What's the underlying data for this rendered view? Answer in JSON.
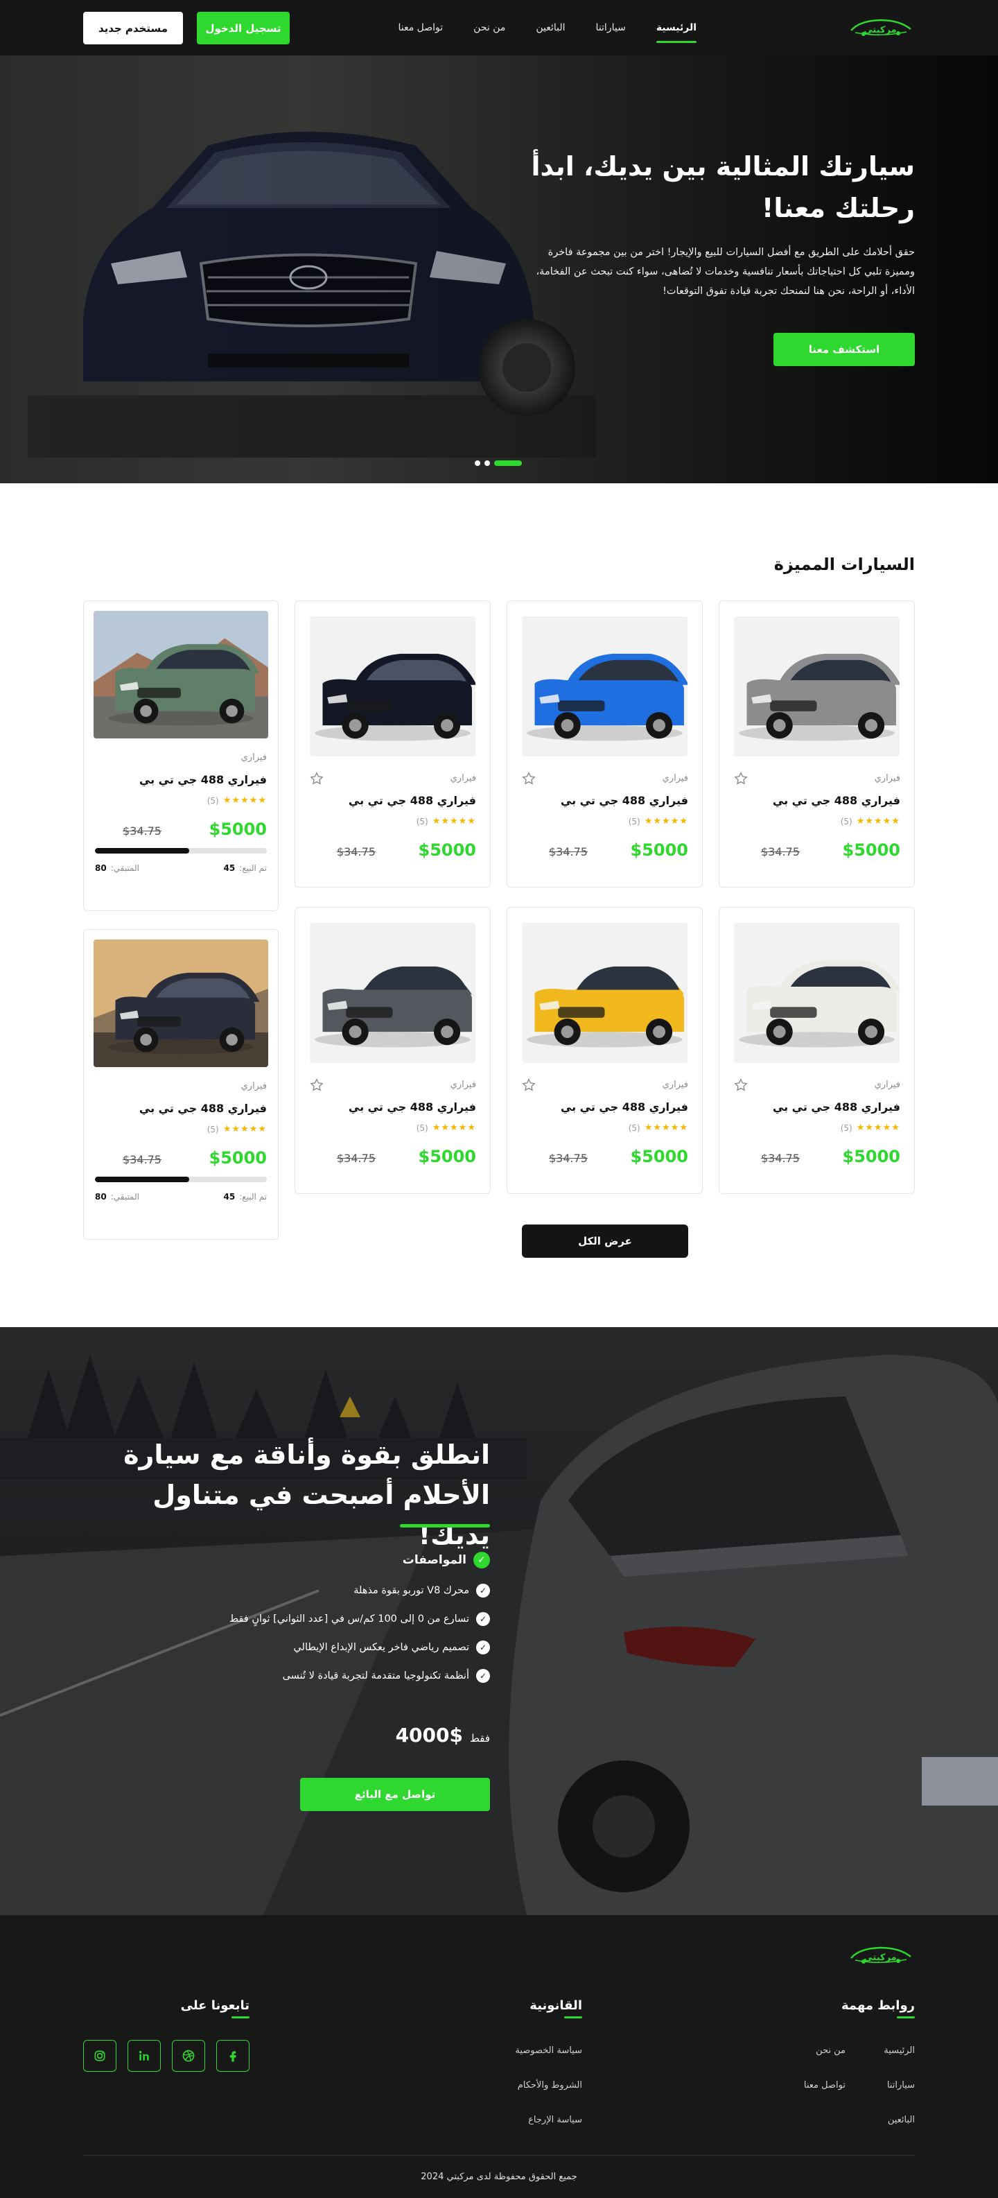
{
  "brand_color": "#2fd82f",
  "logo": {
    "text": "مركبتي"
  },
  "nav": {
    "links": [
      "الرئيسية",
      "سياراتنا",
      "البائعين",
      "من نحن",
      "تواصل معنا"
    ],
    "login_label": "تسجيل الدخول",
    "register_label": "مستخدم جديد"
  },
  "hero": {
    "title": "سيارتك المثالية بين يديك، ابدأ رحلتك معنا!",
    "description": "حقق أحلامك على الطريق مع أفضل السيارات للبيع والإيجار! اختر من بين مجموعة فاخرة ومميزة تلبي كل احتياجاتك بأسعار تنافسية وخدمات لا تُضاهى، سواء كنت تبحث عن الفخامة، الأداء، أو الراحة، نحن هنا لنمنحك تجربة قيادة تفوق التوقعات!",
    "cta_label": "استكشف معنا",
    "slides": 3,
    "active_slide": 1
  },
  "featured": {
    "title": "السيارات المميزة",
    "view_all_label": "عرض الكل",
    "cards": [
      {
        "brand": "فيراري",
        "name": "فيراري 488 جي تي بي",
        "rating_count": "(5)",
        "price": "$5000",
        "old_price": "$34.75",
        "color": "#8c8c8e",
        "icon": "suv-gray"
      },
      {
        "brand": "فيراري",
        "name": "فيراري 488 جي تي بي",
        "rating_count": "(5)",
        "price": "$5000",
        "old_price": "$34.75",
        "color": "#1f6fe0",
        "icon": "hatch-blue"
      },
      {
        "brand": "فيراري",
        "name": "فيراري 488 جي تي بي",
        "rating_count": "(5)",
        "price": "$5000",
        "old_price": "$34.75",
        "color": "#141826",
        "icon": "suv-black"
      },
      {
        "brand": "فيراري",
        "name": "فيراري 488 جي تي بي",
        "rating_count": "(5)",
        "price": "$5000",
        "old_price": "$34.75",
        "color": "#ecebe6",
        "icon": "suv-white"
      },
      {
        "brand": "فيراري",
        "name": "فيراري 488 جي تي بي",
        "rating_count": "(5)",
        "price": "$5000",
        "old_price": "$34.75",
        "color": "#f0b81c",
        "icon": "coupe-yellow"
      },
      {
        "brand": "فيراري",
        "name": "فيراري 488 جي تي بي",
        "rating_count": "(5)",
        "price": "$5000",
        "old_price": "$34.75",
        "color": "#54585e",
        "icon": "sedan-gray"
      }
    ],
    "side_cards": [
      {
        "brand": "فيراري",
        "name": "فيراري 488 جي تي بي",
        "rating_count": "(5)",
        "price": "$5000",
        "old_price": "$34.75",
        "sold_label": "تم البيع:",
        "sold": "45",
        "left_label": "المتبقي:",
        "left": "80",
        "progress": 0.55,
        "color": "#5f7f68",
        "icon": "suv-green"
      },
      {
        "brand": "فيراري",
        "name": "فيراري 488 جي تي بي",
        "rating_count": "(5)",
        "price": "$5000",
        "old_price": "$34.75",
        "sold_label": "تم البيع:",
        "sold": "45",
        "left_label": "المتبقي:",
        "left": "80",
        "progress": 0.55,
        "color": "#2a2e3a",
        "icon": "suv-dark"
      }
    ]
  },
  "promo": {
    "title": "انطلق بقوة وأناقة مع سيارة الأحلام أصبحت في متناول يديك!",
    "specs_title": "المواصفات",
    "specs": [
      "محرك V8 توربو بقوة مذهلة",
      "تسارع من 0 إلى 100 كم/س في [عدد الثواني] ثوانٍ فقط",
      "تصميم رياضي فاخر يعكس الإبداع الإيطالي",
      "أنظمة تكنولوجيا متقدمة لتجربة قيادة لا تُنسى"
    ],
    "price_prefix": "فقط",
    "price": "4000$",
    "cta_label": "تواصل مع البائع"
  },
  "footer": {
    "links_title": "روابط مهمة",
    "links_col1": [
      "الرئيسية",
      "سياراتنا",
      "البائعين"
    ],
    "links_col2": [
      "من نحن",
      "تواصل معنا"
    ],
    "legal_title": "القانونية",
    "legal": [
      "سياسة الخصوصية",
      "الشروط والأحكام",
      "سياسة الإرجاع"
    ],
    "social_title": "تابعونا على",
    "social": [
      "facebook-icon",
      "dribbble-icon",
      "linkedin-icon",
      "instagram-icon"
    ],
    "copyright": "جميع الحقوق محفوظة لدى مركبتي 2024"
  }
}
